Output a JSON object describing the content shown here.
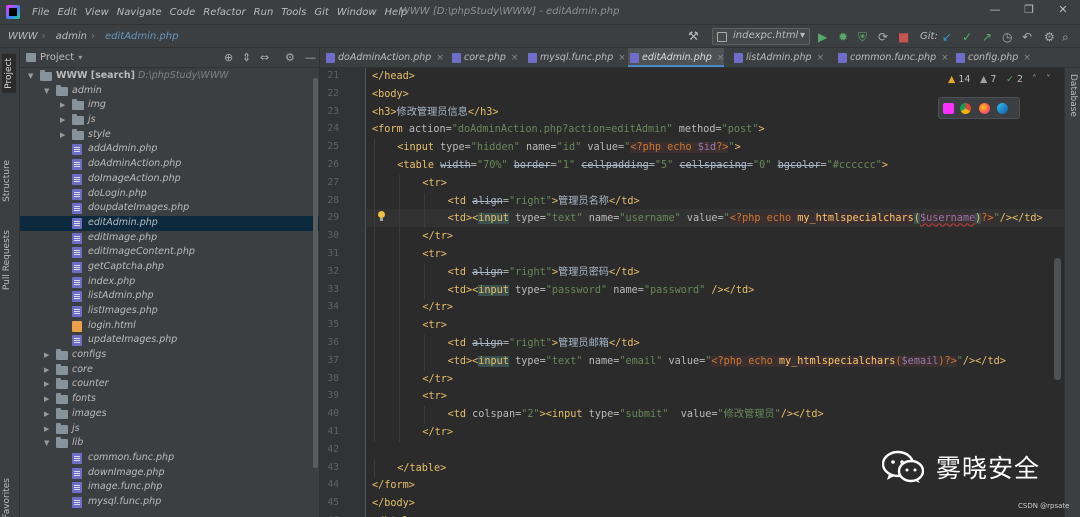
{
  "menubar": {
    "items": [
      "File",
      "Edit",
      "View",
      "Navigate",
      "Code",
      "Refactor",
      "Run",
      "Tools",
      "Git",
      "Window",
      "Help"
    ],
    "window_title": "WWW [D:\\phpStudy\\WWW] - editAdmin.php",
    "controls": [
      "—",
      "❐",
      "✕"
    ]
  },
  "navbar": {
    "breadcrumbs": [
      "WWW",
      "admin",
      "editAdmin.php"
    ],
    "run_config": "indexpc.html",
    "git_label": "Git:"
  },
  "left_strip": {
    "tabs": [
      "Project",
      "Structure",
      "Pull Requests",
      "Favorites"
    ]
  },
  "right_strip": {
    "tabs": [
      "Database"
    ]
  },
  "project_panel": {
    "title": "Project",
    "tree": [
      {
        "depth": 0,
        "kind": "folder",
        "expanded": true,
        "label": "WWW [search]",
        "hint": "D:\\phpStudy\\WWW"
      },
      {
        "depth": 1,
        "kind": "folder",
        "expanded": true,
        "label": "admin"
      },
      {
        "depth": 2,
        "kind": "folder",
        "expanded": false,
        "label": "img"
      },
      {
        "depth": 2,
        "kind": "folder",
        "expanded": false,
        "label": "js"
      },
      {
        "depth": 2,
        "kind": "folder",
        "expanded": false,
        "label": "style"
      },
      {
        "depth": 2,
        "kind": "php",
        "label": "addAdmin.php"
      },
      {
        "depth": 2,
        "kind": "php",
        "label": "doAdminAction.php"
      },
      {
        "depth": 2,
        "kind": "php",
        "label": "doImageAction.php"
      },
      {
        "depth": 2,
        "kind": "php",
        "label": "doLogin.php"
      },
      {
        "depth": 2,
        "kind": "php",
        "label": "doupdateImages.php"
      },
      {
        "depth": 2,
        "kind": "php",
        "label": "editAdmin.php",
        "selected": true
      },
      {
        "depth": 2,
        "kind": "php",
        "label": "editImage.php"
      },
      {
        "depth": 2,
        "kind": "php",
        "label": "editImageContent.php"
      },
      {
        "depth": 2,
        "kind": "php",
        "label": "getCaptcha.php"
      },
      {
        "depth": 2,
        "kind": "php",
        "label": "index.php"
      },
      {
        "depth": 2,
        "kind": "php",
        "label": "listAdmin.php"
      },
      {
        "depth": 2,
        "kind": "php",
        "label": "listImages.php"
      },
      {
        "depth": 2,
        "kind": "html",
        "label": "login.html"
      },
      {
        "depth": 2,
        "kind": "php",
        "label": "updateImages.php"
      },
      {
        "depth": 1,
        "kind": "folder",
        "expanded": false,
        "label": "configs"
      },
      {
        "depth": 1,
        "kind": "folder",
        "expanded": false,
        "label": "core"
      },
      {
        "depth": 1,
        "kind": "folder",
        "expanded": false,
        "label": "counter"
      },
      {
        "depth": 1,
        "kind": "folder",
        "expanded": false,
        "label": "fonts"
      },
      {
        "depth": 1,
        "kind": "folder",
        "expanded": false,
        "label": "images"
      },
      {
        "depth": 1,
        "kind": "folder",
        "expanded": false,
        "label": "js"
      },
      {
        "depth": 1,
        "kind": "folder",
        "expanded": true,
        "label": "lib"
      },
      {
        "depth": 2,
        "kind": "php",
        "label": "common.func.php"
      },
      {
        "depth": 2,
        "kind": "php",
        "label": "downImage.php"
      },
      {
        "depth": 2,
        "kind": "php",
        "label": "image.func.php"
      },
      {
        "depth": 2,
        "kind": "php",
        "label": "mysql.func.php"
      }
    ]
  },
  "editor_tabs": [
    {
      "label": "doAdminAction.php",
      "active": false
    },
    {
      "label": "core.php",
      "active": false
    },
    {
      "label": "mysql.func.php",
      "active": false
    },
    {
      "label": "editAdmin.php",
      "active": true
    },
    {
      "label": "listAdmin.php",
      "active": false
    },
    {
      "label": "common.func.php",
      "active": false
    },
    {
      "label": "config.php",
      "active": false
    }
  ],
  "inspections": {
    "warnings": "14",
    "weak_warnings": "7",
    "typos": "2"
  },
  "editor": {
    "current_line": 29,
    "lines": [
      {
        "n": "21",
        "indent": 0,
        "tokens": [
          [
            "tag",
            "</head>"
          ]
        ]
      },
      {
        "n": "22",
        "indent": 0,
        "tokens": [
          [
            "tag",
            "<body>"
          ]
        ]
      },
      {
        "n": "23",
        "indent": 0,
        "tokens": [
          [
            "tag",
            "<h3>"
          ],
          [
            "text",
            "修改管理员信息"
          ],
          [
            "tag",
            "</h3>"
          ]
        ]
      },
      {
        "n": "24",
        "indent": 0,
        "tokens": [
          [
            "tag",
            "<form "
          ],
          [
            "attr",
            "action="
          ],
          [
            "str",
            "\"doAdminAction.php?action=editAdmin\""
          ],
          [
            "attr",
            " method="
          ],
          [
            "str",
            "\"post\""
          ],
          [
            "tag",
            ">"
          ]
        ]
      },
      {
        "n": "25",
        "indent": 1,
        "tokens": [
          [
            "tag",
            "<input "
          ],
          [
            "attr",
            "type="
          ],
          [
            "str",
            "\"hidden\""
          ],
          [
            "attr",
            " name="
          ],
          [
            "str",
            "\"id\""
          ],
          [
            "attr",
            " value="
          ],
          [
            "str",
            "\""
          ],
          [
            "php",
            "<?php echo "
          ],
          [
            "var",
            "$id"
          ],
          [
            "php",
            "?>"
          ],
          [
            "str",
            "\""
          ],
          [
            "tag",
            ">"
          ]
        ]
      },
      {
        "n": "26",
        "indent": 1,
        "tokens": [
          [
            "tag",
            "<table "
          ],
          [
            "dep",
            "width"
          ],
          [
            "attr",
            "="
          ],
          [
            "str",
            "\"70%\""
          ],
          [
            "attr",
            " "
          ],
          [
            "dep",
            "border"
          ],
          [
            "attr",
            "="
          ],
          [
            "str",
            "\"1\""
          ],
          [
            "attr",
            " "
          ],
          [
            "dep",
            "cellpadding"
          ],
          [
            "attr",
            "="
          ],
          [
            "str",
            "\"5\""
          ],
          [
            "attr",
            " "
          ],
          [
            "dep",
            "cellspacing"
          ],
          [
            "attr",
            "="
          ],
          [
            "str",
            "\"0\""
          ],
          [
            "attr",
            " "
          ],
          [
            "dep",
            "bgcolor"
          ],
          [
            "attr",
            "="
          ],
          [
            "str",
            "\"#cccccc\""
          ],
          [
            "tag",
            ">"
          ]
        ]
      },
      {
        "n": "27",
        "indent": 2,
        "tokens": [
          [
            "tag",
            "<tr>"
          ]
        ]
      },
      {
        "n": "28",
        "indent": 3,
        "tokens": [
          [
            "tag",
            "<td "
          ],
          [
            "dep",
            "align"
          ],
          [
            "attr",
            "="
          ],
          [
            "str",
            "\"right\""
          ],
          [
            "tag",
            ">"
          ],
          [
            "text",
            "管理员名称"
          ],
          [
            "tag",
            "</td>"
          ]
        ]
      },
      {
        "n": "29",
        "indent": 3,
        "tokens": [
          [
            "tag",
            "<td><"
          ],
          [
            "match",
            "input"
          ],
          [
            "attr",
            " type="
          ],
          [
            "str",
            "\"text\""
          ],
          [
            "attr",
            " name="
          ],
          [
            "str",
            "\"username\""
          ],
          [
            "attr",
            " value="
          ],
          [
            "str",
            "\""
          ],
          [
            "php",
            "<?php echo "
          ],
          [
            "fn",
            "my_htmlspecialchars"
          ],
          [
            "match",
            "("
          ],
          [
            "varerr",
            "$username"
          ],
          [
            "match",
            ")"
          ],
          [
            "php",
            "?>"
          ],
          [
            "str",
            "\""
          ],
          [
            "tag",
            "/></td>"
          ]
        ]
      },
      {
        "n": "30",
        "indent": 2,
        "tokens": [
          [
            "tag",
            "</tr>"
          ]
        ]
      },
      {
        "n": "31",
        "indent": 2,
        "tokens": [
          [
            "tag",
            "<tr>"
          ]
        ]
      },
      {
        "n": "32",
        "indent": 3,
        "tokens": [
          [
            "tag",
            "<td "
          ],
          [
            "dep",
            "align"
          ],
          [
            "attr",
            "="
          ],
          [
            "str",
            "\"right\""
          ],
          [
            "tag",
            ">"
          ],
          [
            "text",
            "管理员密码"
          ],
          [
            "tag",
            "</td>"
          ]
        ]
      },
      {
        "n": "33",
        "indent": 3,
        "tokens": [
          [
            "tag",
            "<td><"
          ],
          [
            "match",
            "input"
          ],
          [
            "attr",
            " type="
          ],
          [
            "str",
            "\"password\""
          ],
          [
            "attr",
            " name="
          ],
          [
            "str",
            "\"password\""
          ],
          [
            "tag",
            " /></td>"
          ]
        ]
      },
      {
        "n": "34",
        "indent": 2,
        "tokens": [
          [
            "tag",
            "</tr>"
          ]
        ]
      },
      {
        "n": "35",
        "indent": 2,
        "tokens": [
          [
            "tag",
            "<tr>"
          ]
        ]
      },
      {
        "n": "36",
        "indent": 3,
        "tokens": [
          [
            "tag",
            "<td "
          ],
          [
            "dep",
            "align"
          ],
          [
            "attr",
            "="
          ],
          [
            "str",
            "\"right\""
          ],
          [
            "tag",
            ">"
          ],
          [
            "text",
            "管理员邮箱"
          ],
          [
            "tag",
            "</td>"
          ]
        ]
      },
      {
        "n": "37",
        "indent": 3,
        "tokens": [
          [
            "tag",
            "<td><"
          ],
          [
            "match",
            "input"
          ],
          [
            "attr",
            " type="
          ],
          [
            "str",
            "\"text\""
          ],
          [
            "attr",
            " name="
          ],
          [
            "str",
            "\"email\""
          ],
          [
            "attr",
            " value="
          ],
          [
            "str",
            "\""
          ],
          [
            "php",
            "<?php echo "
          ],
          [
            "fn",
            "my_htmlspecialchars"
          ],
          [
            "php",
            "("
          ],
          [
            "var",
            "$email"
          ],
          [
            "php",
            ")?>"
          ],
          [
            "str",
            "\""
          ],
          [
            "tag",
            "/></td>"
          ]
        ]
      },
      {
        "n": "38",
        "indent": 2,
        "tokens": [
          [
            "tag",
            "</tr>"
          ]
        ]
      },
      {
        "n": "39",
        "indent": 2,
        "tokens": [
          [
            "tag",
            "<tr>"
          ]
        ]
      },
      {
        "n": "40",
        "indent": 3,
        "tokens": [
          [
            "tag",
            "<td "
          ],
          [
            "attr",
            "colspan="
          ],
          [
            "str",
            "\"2\""
          ],
          [
            "tag",
            "><input "
          ],
          [
            "attr",
            "type="
          ],
          [
            "str",
            "\"submit\""
          ],
          [
            "attr",
            "  value="
          ],
          [
            "str",
            "\"修改管理员\""
          ],
          [
            "tag",
            "/></td>"
          ]
        ]
      },
      {
        "n": "41",
        "indent": 2,
        "tokens": [
          [
            "tag",
            "</tr>"
          ]
        ]
      },
      {
        "n": "42",
        "indent": 0,
        "tokens": []
      },
      {
        "n": "43",
        "indent": 1,
        "tokens": [
          [
            "tag",
            "</table>"
          ]
        ]
      },
      {
        "n": "44",
        "indent": 0,
        "tokens": [
          [
            "tag",
            "</form>"
          ]
        ]
      },
      {
        "n": "45",
        "indent": 0,
        "tokens": [
          [
            "tag",
            "</body>"
          ]
        ]
      },
      {
        "n": "46",
        "indent": 0,
        "tokens": [
          [
            "tag",
            "</html>"
          ]
        ]
      }
    ]
  },
  "watermark": {
    "text": "雾晓安全",
    "credit": "CSDN @rpsate"
  },
  "colors": {
    "bg": "#2b2b2b",
    "panel": "#3c3f41",
    "tag": "#e8bf6a",
    "string": "#6a8759",
    "php_keyword": "#cc7832",
    "variable": "#9876aa",
    "function": "#ffc66d",
    "selection": "#0d293e",
    "accent": "#4a88c7"
  }
}
